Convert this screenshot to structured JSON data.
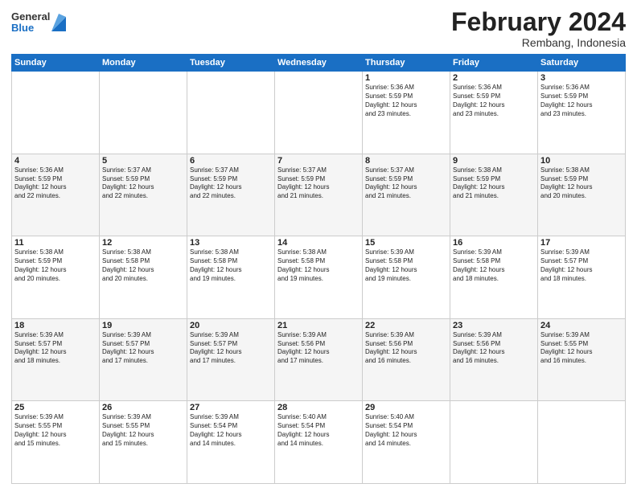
{
  "header": {
    "logo_general": "General",
    "logo_blue": "Blue",
    "month_title": "February 2024",
    "location": "Rembang, Indonesia"
  },
  "calendar": {
    "days_of_week": [
      "Sunday",
      "Monday",
      "Tuesday",
      "Wednesday",
      "Thursday",
      "Friday",
      "Saturday"
    ],
    "weeks": [
      [
        {
          "day": "",
          "info": ""
        },
        {
          "day": "",
          "info": ""
        },
        {
          "day": "",
          "info": ""
        },
        {
          "day": "",
          "info": ""
        },
        {
          "day": "1",
          "info": "Sunrise: 5:36 AM\nSunset: 5:59 PM\nDaylight: 12 hours\nand 23 minutes."
        },
        {
          "day": "2",
          "info": "Sunrise: 5:36 AM\nSunset: 5:59 PM\nDaylight: 12 hours\nand 23 minutes."
        },
        {
          "day": "3",
          "info": "Sunrise: 5:36 AM\nSunset: 5:59 PM\nDaylight: 12 hours\nand 23 minutes."
        }
      ],
      [
        {
          "day": "4",
          "info": "Sunrise: 5:36 AM\nSunset: 5:59 PM\nDaylight: 12 hours\nand 22 minutes."
        },
        {
          "day": "5",
          "info": "Sunrise: 5:37 AM\nSunset: 5:59 PM\nDaylight: 12 hours\nand 22 minutes."
        },
        {
          "day": "6",
          "info": "Sunrise: 5:37 AM\nSunset: 5:59 PM\nDaylight: 12 hours\nand 22 minutes."
        },
        {
          "day": "7",
          "info": "Sunrise: 5:37 AM\nSunset: 5:59 PM\nDaylight: 12 hours\nand 21 minutes."
        },
        {
          "day": "8",
          "info": "Sunrise: 5:37 AM\nSunset: 5:59 PM\nDaylight: 12 hours\nand 21 minutes."
        },
        {
          "day": "9",
          "info": "Sunrise: 5:38 AM\nSunset: 5:59 PM\nDaylight: 12 hours\nand 21 minutes."
        },
        {
          "day": "10",
          "info": "Sunrise: 5:38 AM\nSunset: 5:59 PM\nDaylight: 12 hours\nand 20 minutes."
        }
      ],
      [
        {
          "day": "11",
          "info": "Sunrise: 5:38 AM\nSunset: 5:59 PM\nDaylight: 12 hours\nand 20 minutes."
        },
        {
          "day": "12",
          "info": "Sunrise: 5:38 AM\nSunset: 5:58 PM\nDaylight: 12 hours\nand 20 minutes."
        },
        {
          "day": "13",
          "info": "Sunrise: 5:38 AM\nSunset: 5:58 PM\nDaylight: 12 hours\nand 19 minutes."
        },
        {
          "day": "14",
          "info": "Sunrise: 5:38 AM\nSunset: 5:58 PM\nDaylight: 12 hours\nand 19 minutes."
        },
        {
          "day": "15",
          "info": "Sunrise: 5:39 AM\nSunset: 5:58 PM\nDaylight: 12 hours\nand 19 minutes."
        },
        {
          "day": "16",
          "info": "Sunrise: 5:39 AM\nSunset: 5:58 PM\nDaylight: 12 hours\nand 18 minutes."
        },
        {
          "day": "17",
          "info": "Sunrise: 5:39 AM\nSunset: 5:57 PM\nDaylight: 12 hours\nand 18 minutes."
        }
      ],
      [
        {
          "day": "18",
          "info": "Sunrise: 5:39 AM\nSunset: 5:57 PM\nDaylight: 12 hours\nand 18 minutes."
        },
        {
          "day": "19",
          "info": "Sunrise: 5:39 AM\nSunset: 5:57 PM\nDaylight: 12 hours\nand 17 minutes."
        },
        {
          "day": "20",
          "info": "Sunrise: 5:39 AM\nSunset: 5:57 PM\nDaylight: 12 hours\nand 17 minutes."
        },
        {
          "day": "21",
          "info": "Sunrise: 5:39 AM\nSunset: 5:56 PM\nDaylight: 12 hours\nand 17 minutes."
        },
        {
          "day": "22",
          "info": "Sunrise: 5:39 AM\nSunset: 5:56 PM\nDaylight: 12 hours\nand 16 minutes."
        },
        {
          "day": "23",
          "info": "Sunrise: 5:39 AM\nSunset: 5:56 PM\nDaylight: 12 hours\nand 16 minutes."
        },
        {
          "day": "24",
          "info": "Sunrise: 5:39 AM\nSunset: 5:55 PM\nDaylight: 12 hours\nand 16 minutes."
        }
      ],
      [
        {
          "day": "25",
          "info": "Sunrise: 5:39 AM\nSunset: 5:55 PM\nDaylight: 12 hours\nand 15 minutes."
        },
        {
          "day": "26",
          "info": "Sunrise: 5:39 AM\nSunset: 5:55 PM\nDaylight: 12 hours\nand 15 minutes."
        },
        {
          "day": "27",
          "info": "Sunrise: 5:39 AM\nSunset: 5:54 PM\nDaylight: 12 hours\nand 14 minutes."
        },
        {
          "day": "28",
          "info": "Sunrise: 5:40 AM\nSunset: 5:54 PM\nDaylight: 12 hours\nand 14 minutes."
        },
        {
          "day": "29",
          "info": "Sunrise: 5:40 AM\nSunset: 5:54 PM\nDaylight: 12 hours\nand 14 minutes."
        },
        {
          "day": "",
          "info": ""
        },
        {
          "day": "",
          "info": ""
        }
      ]
    ]
  }
}
